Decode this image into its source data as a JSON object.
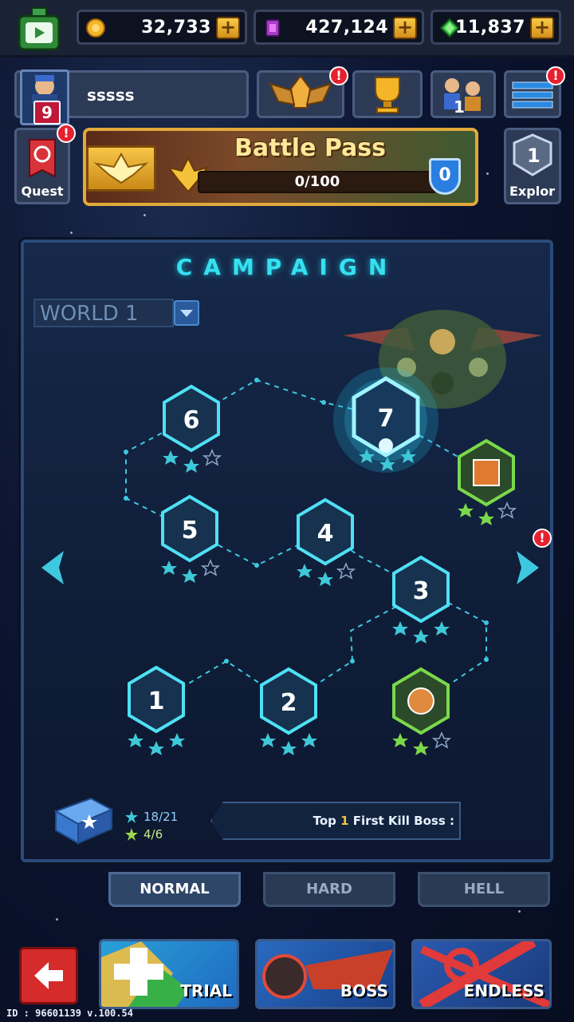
{
  "resources": {
    "coins": "32,733",
    "gems_purple": "427,124",
    "crystals": "11,837",
    "plus": "+"
  },
  "profile": {
    "name": "sssss",
    "level": "9"
  },
  "badges": {
    "alert": "!"
  },
  "quest": {
    "label": "Quest"
  },
  "battle_pass": {
    "title": "Battle Pass",
    "progress": "0/100",
    "progress_fraction": 0,
    "level": "0"
  },
  "explore": {
    "label": "Explor",
    "count": "1"
  },
  "campaign": {
    "title": "CAMPAIGN",
    "world": "WORLD 1",
    "nodes": [
      "1",
      "2",
      "3",
      "4",
      "5",
      "6",
      "7"
    ],
    "stars_total": "18/21",
    "boss_stars": "4/6",
    "top_kill_prefix": "Top",
    "top_kill_rank": "1",
    "top_kill_suffix": "First Kill Boss :"
  },
  "difficulty": {
    "normal": "NORMAL",
    "hard": "HARD",
    "hell": "HELL"
  },
  "modes": {
    "trial": "TRIAL",
    "boss": "BOSS",
    "endless": "ENDLESS"
  },
  "footer": {
    "id": "ID : 96601139 v.100.54"
  },
  "colors": {
    "accent": "#36e0f0",
    "gold": "#f0c040",
    "alert": "#e6202e"
  }
}
